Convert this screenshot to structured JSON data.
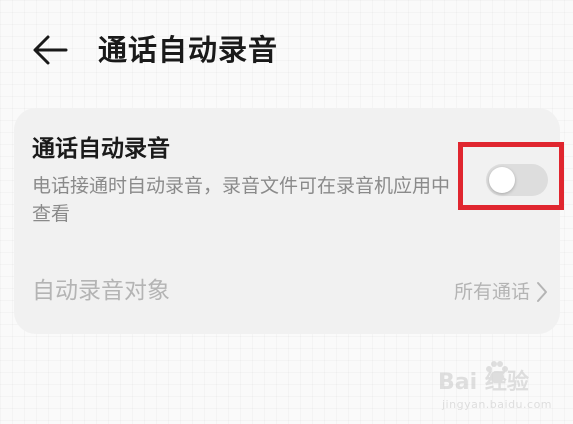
{
  "header": {
    "back_icon": "arrow-left-icon",
    "title": "通话自动录音"
  },
  "auto_record": {
    "title": "通话自动录音",
    "description": "电话接通时自动录音，录音文件可在录音机应用中查看",
    "toggle_state": "off"
  },
  "record_target": {
    "label": "自动录音对象",
    "value": "所有通话",
    "chevron_icon": "chevron-right-icon"
  },
  "colors": {
    "highlight_border": "#e0262f",
    "card_background": "#f1f1f1",
    "toggle_off_track": "#dddddd"
  },
  "watermark": {
    "brand": "Bai  经验",
    "url": "jingyan.baidu.com"
  }
}
